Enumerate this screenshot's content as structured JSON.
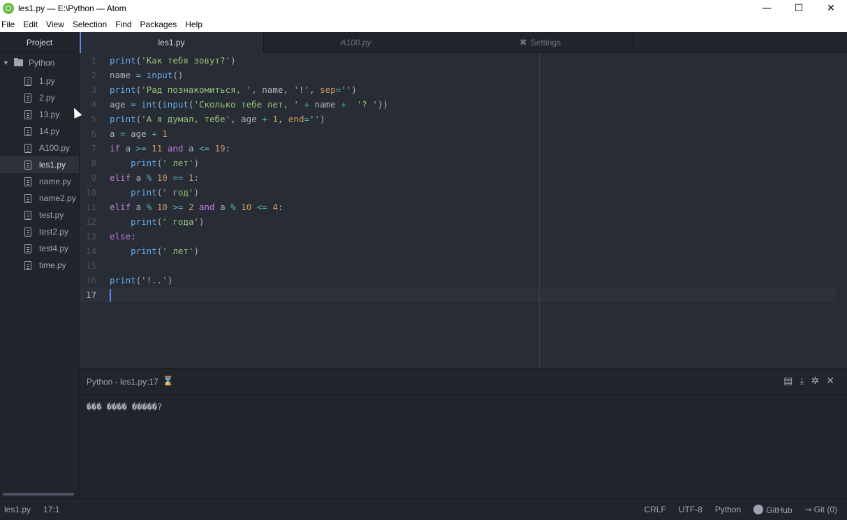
{
  "window": {
    "title": "les1.py — E:\\Python — Atom",
    "controls": {
      "minimize": "—",
      "maximize": "☐",
      "close": "✕"
    }
  },
  "menu": [
    "File",
    "Edit",
    "View",
    "Selection",
    "Find",
    "Packages",
    "Help"
  ],
  "sidebar": {
    "header": "Project",
    "folder": "Python",
    "files": [
      "1.py",
      "2.py",
      "13.py",
      "14.py",
      "A100.py",
      "les1.py",
      "name.py",
      "name2.py",
      "test.py",
      "test2.py",
      "test4.py",
      "time.py"
    ],
    "active_file": "les1.py"
  },
  "tabs": [
    {
      "label": "les1.py",
      "active": true
    },
    {
      "label": "A100.py",
      "active": false
    },
    {
      "label": "Settings",
      "active": false,
      "icon": "tools-icon"
    }
  ],
  "editor": {
    "cursor_line": 17,
    "line_numbers": [
      "1",
      "2",
      "3",
      "4",
      "5",
      "6",
      "7",
      "8",
      "9",
      "10",
      "11",
      "12",
      "13",
      "14",
      "15",
      "16",
      "17"
    ],
    "code": [
      [
        [
          "f",
          "print"
        ],
        [
          "c",
          "("
        ],
        [
          "s",
          "'Как тебя зовут?'"
        ],
        [
          "c",
          ")"
        ]
      ],
      [
        [
          "c",
          "name "
        ],
        [
          "o",
          "="
        ],
        [
          "c",
          " "
        ],
        [
          "f",
          "input"
        ],
        [
          "c",
          "()"
        ]
      ],
      [
        [
          "f",
          "print"
        ],
        [
          "c",
          "("
        ],
        [
          "s",
          "'Рад познакомиться, '"
        ],
        [
          "c",
          ", name, "
        ],
        [
          "s",
          "'!'"
        ],
        [
          "c",
          ", "
        ],
        [
          "n",
          "sep"
        ],
        [
          "o",
          "="
        ],
        [
          "s",
          "''"
        ],
        [
          "c",
          ")"
        ]
      ],
      [
        [
          "c",
          "age "
        ],
        [
          "o",
          "="
        ],
        [
          "c",
          " "
        ],
        [
          "f",
          "int"
        ],
        [
          "c",
          "("
        ],
        [
          "f",
          "input"
        ],
        [
          "c",
          "("
        ],
        [
          "s",
          "'Сколько тебе лет, '"
        ],
        [
          "c",
          " "
        ],
        [
          "o",
          "+"
        ],
        [
          "c",
          " name "
        ],
        [
          "o",
          "+"
        ],
        [
          "c",
          "  "
        ],
        [
          "s",
          "'? '"
        ],
        [
          "c",
          "))"
        ]
      ],
      [
        [
          "f",
          "print"
        ],
        [
          "c",
          "("
        ],
        [
          "s",
          "'А я думал, тебе'"
        ],
        [
          "c",
          ", age "
        ],
        [
          "o",
          "+"
        ],
        [
          "c",
          " "
        ],
        [
          "n",
          "1"
        ],
        [
          "c",
          ", "
        ],
        [
          "n",
          "end"
        ],
        [
          "o",
          "="
        ],
        [
          "s",
          "''"
        ],
        [
          "c",
          ")"
        ]
      ],
      [
        [
          "c",
          "a "
        ],
        [
          "o",
          "="
        ],
        [
          "c",
          " age "
        ],
        [
          "o",
          "+"
        ],
        [
          "c",
          " "
        ],
        [
          "n",
          "1"
        ]
      ],
      [
        [
          "k",
          "if"
        ],
        [
          "c",
          " a "
        ],
        [
          "o",
          ">="
        ],
        [
          "c",
          " "
        ],
        [
          "n",
          "11"
        ],
        [
          "c",
          " "
        ],
        [
          "k",
          "and"
        ],
        [
          "c",
          " a "
        ],
        [
          "o",
          "<="
        ],
        [
          "c",
          " "
        ],
        [
          "n",
          "19"
        ],
        [
          "c",
          ":"
        ]
      ],
      [
        [
          "c",
          "    "
        ],
        [
          "f",
          "print"
        ],
        [
          "c",
          "("
        ],
        [
          "s",
          "' лет'"
        ],
        [
          "c",
          ")"
        ]
      ],
      [
        [
          "k",
          "elif"
        ],
        [
          "c",
          " a "
        ],
        [
          "o",
          "%"
        ],
        [
          "c",
          " "
        ],
        [
          "n",
          "10"
        ],
        [
          "c",
          " "
        ],
        [
          "o",
          "=="
        ],
        [
          "c",
          " "
        ],
        [
          "n",
          "1"
        ],
        [
          "c",
          ":"
        ]
      ],
      [
        [
          "c",
          "    "
        ],
        [
          "f",
          "print"
        ],
        [
          "c",
          "("
        ],
        [
          "s",
          "' год'"
        ],
        [
          "c",
          ")"
        ]
      ],
      [
        [
          "k",
          "elif"
        ],
        [
          "c",
          " a "
        ],
        [
          "o",
          "%"
        ],
        [
          "c",
          " "
        ],
        [
          "n",
          "10"
        ],
        [
          "c",
          " "
        ],
        [
          "o",
          ">="
        ],
        [
          "c",
          " "
        ],
        [
          "n",
          "2"
        ],
        [
          "c",
          " "
        ],
        [
          "k",
          "and"
        ],
        [
          "c",
          " a "
        ],
        [
          "o",
          "%"
        ],
        [
          "c",
          " "
        ],
        [
          "n",
          "10"
        ],
        [
          "c",
          " "
        ],
        [
          "o",
          "<="
        ],
        [
          "c",
          " "
        ],
        [
          "n",
          "4"
        ],
        [
          "c",
          ":"
        ]
      ],
      [
        [
          "c",
          "    "
        ],
        [
          "f",
          "print"
        ],
        [
          "c",
          "("
        ],
        [
          "s",
          "' года'"
        ],
        [
          "c",
          ")"
        ]
      ],
      [
        [
          "k",
          "else"
        ],
        [
          "c",
          ":"
        ]
      ],
      [
        [
          "c",
          "    "
        ],
        [
          "f",
          "print"
        ],
        [
          "c",
          "("
        ],
        [
          "s",
          "' лет'"
        ],
        [
          "c",
          ")"
        ]
      ],
      [],
      [
        [
          "f",
          "print"
        ],
        [
          "c",
          "("
        ],
        [
          "s",
          "'!..'"
        ],
        [
          "c",
          ")"
        ]
      ],
      []
    ]
  },
  "console": {
    "title": "Python - les1.py:17",
    "output": "��� ���� �����?"
  },
  "status": {
    "file": "les1.py",
    "position": "17:1",
    "line_ending": "CRLF",
    "encoding": "UTF-8",
    "grammar": "Python",
    "github": "GitHub",
    "git": "Git (0)"
  }
}
